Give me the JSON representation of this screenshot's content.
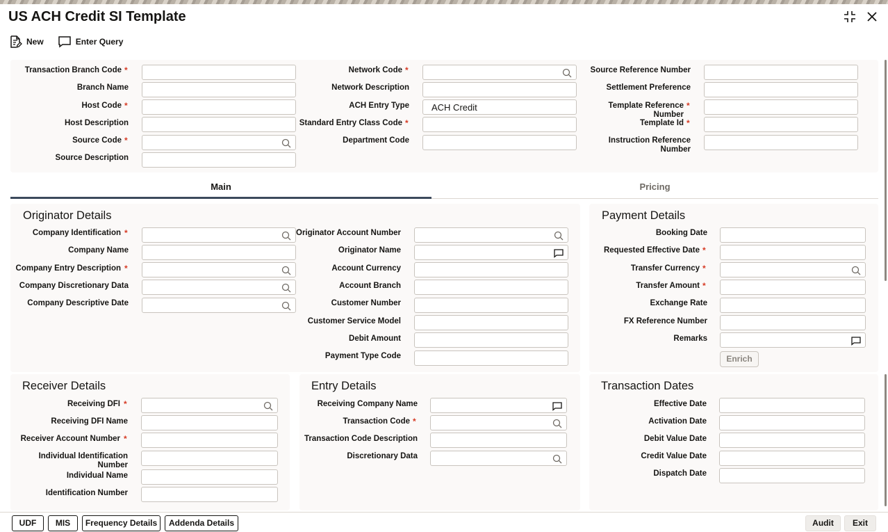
{
  "window": {
    "title": "US ACH Credit SI Template"
  },
  "toolbar": {
    "new_label": "New",
    "enter_query_label": "Enter Query"
  },
  "header": {
    "transaction_branch_code": {
      "label": "Transaction Branch Code",
      "value": ""
    },
    "branch_name": {
      "label": "Branch Name",
      "value": ""
    },
    "host_code": {
      "label": "Host Code",
      "value": ""
    },
    "host_description": {
      "label": "Host Description",
      "value": ""
    },
    "source_code": {
      "label": "Source Code",
      "value": ""
    },
    "source_description": {
      "label": "Source Description",
      "value": ""
    },
    "network_code": {
      "label": "Network Code",
      "value": ""
    },
    "network_description": {
      "label": "Network Description",
      "value": ""
    },
    "ach_entry_type": {
      "label": "ACH Entry Type",
      "value": "ACH Credit"
    },
    "standard_entry_class_code": {
      "label": "Standard Entry Class Code",
      "value": ""
    },
    "department_code": {
      "label": "Department Code",
      "value": ""
    },
    "source_reference_number": {
      "label": "Source Reference Number",
      "value": ""
    },
    "settlement_preference": {
      "label": "Settlement Preference",
      "value": ""
    },
    "template_reference_number": {
      "label": "Template Reference Number",
      "value": ""
    },
    "template_id": {
      "label": "Template Id",
      "value": ""
    },
    "instruction_reference_number": {
      "label": "Instruction Reference Number",
      "value": ""
    },
    "required_marker": "*"
  },
  "tabs": {
    "main": "Main",
    "pricing": "Pricing"
  },
  "originator": {
    "title": "Originator Details",
    "company_identification": "Company Identification",
    "company_name": "Company Name",
    "company_entry_description": "Company Entry Description",
    "company_discretionary_data": "Company Discretionary Data",
    "company_descriptive_date": "Company Descriptive Date",
    "originator_account_number": "Originator Account Number",
    "originator_name": "Originator Name",
    "account_currency": "Account Currency",
    "account_branch": "Account Branch",
    "customer_number": "Customer Number",
    "customer_service_model": "Customer Service Model",
    "debit_amount": "Debit Amount",
    "payment_type_code": "Payment Type Code"
  },
  "payment": {
    "title": "Payment Details",
    "booking_date": "Booking Date",
    "requested_effective_date": "Requested Effective Date",
    "transfer_currency": "Transfer Currency",
    "transfer_amount": "Transfer Amount",
    "exchange_rate": "Exchange Rate",
    "fx_reference_number": "FX Reference Number",
    "remarks": "Remarks",
    "enrich_label": "Enrich"
  },
  "receiver": {
    "title": "Receiver Details",
    "receiving_dfi": "Receiving DFI",
    "receiving_dfi_name": "Receiving DFI Name",
    "receiver_account_number": "Receiver Account Number",
    "individual_identification_number_l1": "Individual Identification",
    "individual_identification_number_l2": "Number",
    "individual_name": "Individual Name",
    "identification_number": "Identification Number"
  },
  "entry": {
    "title": "Entry Details",
    "receiving_company_name": "Receiving Company Name",
    "transaction_code": "Transaction Code",
    "transaction_code_description": "Transaction Code Description",
    "discretionary_data": "Discretionary Data"
  },
  "dates": {
    "title": "Transaction Dates",
    "effective_date": "Effective Date",
    "activation_date": "Activation Date",
    "debit_value_date": "Debit Value Date",
    "credit_value_date": "Credit Value Date",
    "dispatch_date": "Dispatch Date"
  },
  "footer": {
    "udf": "UDF",
    "mis": "MIS",
    "frequency_details": "Frequency Details",
    "addenda_details": "Addenda Details",
    "audit": "Audit",
    "exit": "Exit"
  },
  "colors": {
    "required": "#d63b25",
    "tab_active": "#3c4a5c",
    "panel_bg": "#fbf9f8"
  }
}
